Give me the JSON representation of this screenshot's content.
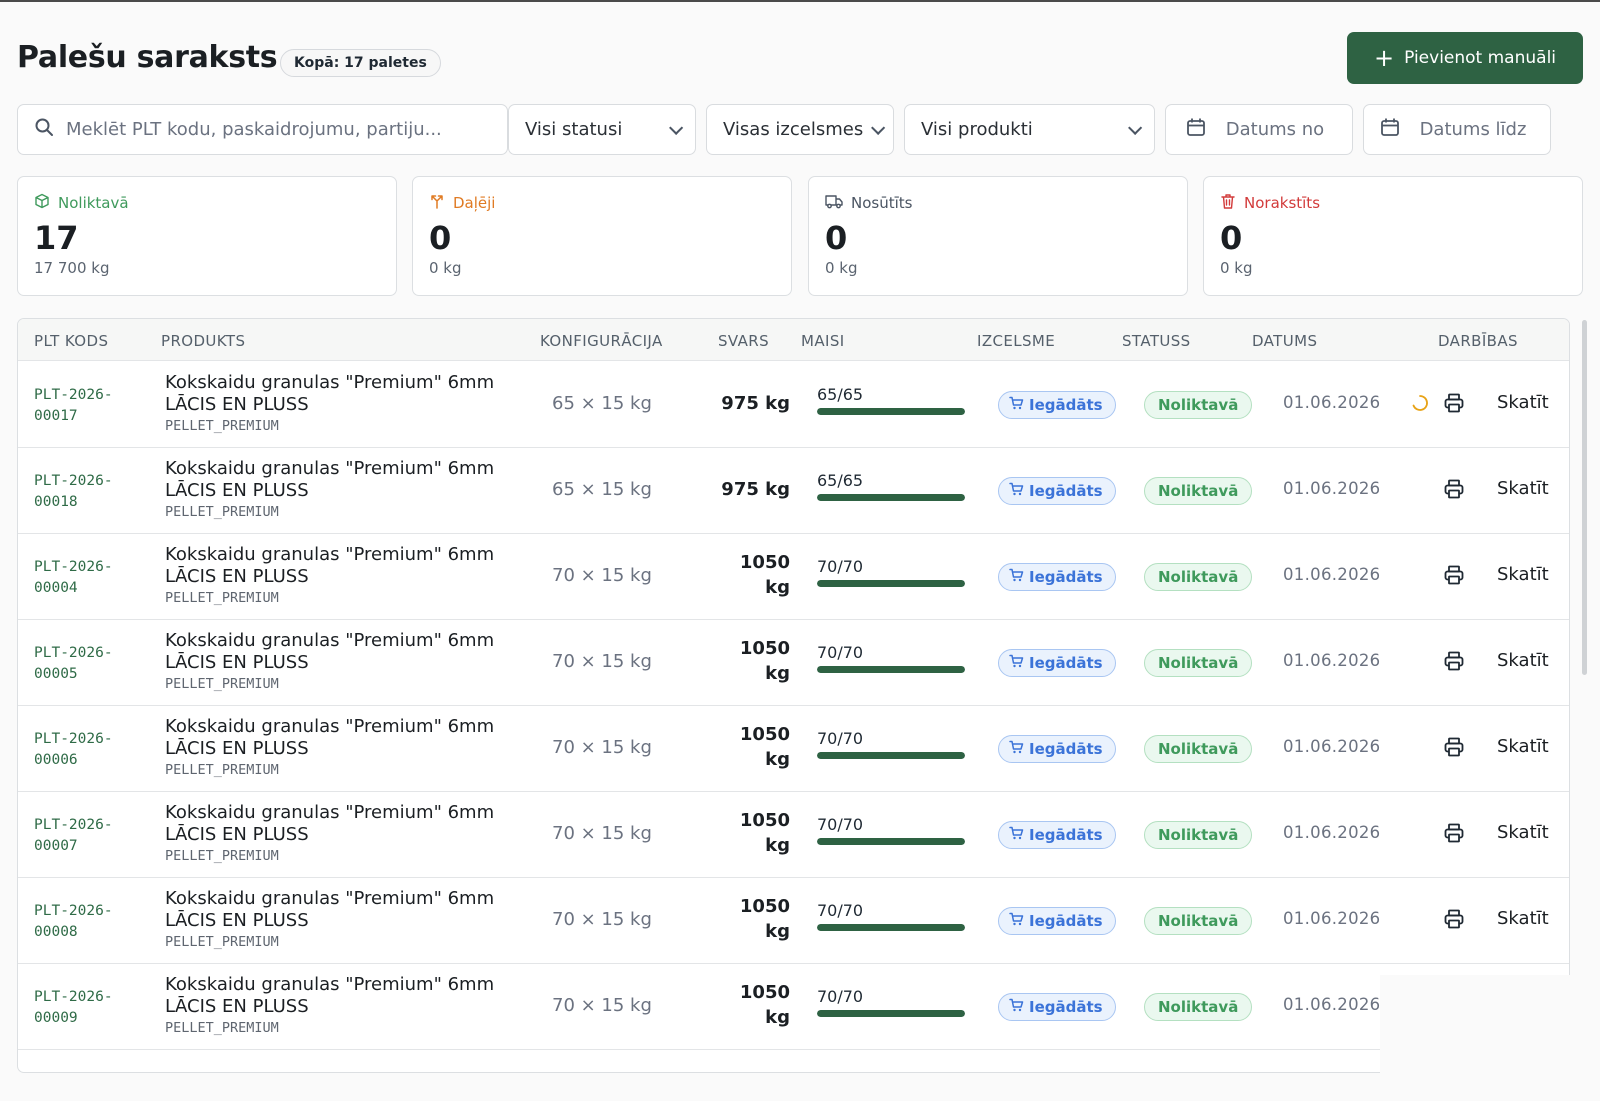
{
  "header": {
    "title": "Palešu saraksts",
    "total_badge": "Kopā: 17 paletes",
    "add_button": "Pievienot manuāli",
    "add_icon": "plus-icon"
  },
  "filters": {
    "search_placeholder": "Meklēt PLT kodu, paskaidrojumu, partiju...",
    "status": "Visi statusi",
    "origin": "Visas izcelsmes",
    "product": "Visi produkti",
    "date_from": "Datums no",
    "date_to": "Datums līdz"
  },
  "stats": [
    {
      "label": "Noliktavā",
      "value": "17",
      "sub": "17 700 kg",
      "color": "#3f9a5c",
      "icon": "box-icon"
    },
    {
      "label": "Daļēji",
      "value": "0",
      "sub": "0 kg",
      "color": "#e07b24",
      "icon": "split-icon"
    },
    {
      "label": "Nosūtīts",
      "value": "0",
      "sub": "0 kg",
      "color": "#4b5563",
      "icon": "truck-icon"
    },
    {
      "label": "Norakstīts",
      "value": "0",
      "sub": "0 kg",
      "color": "#d23b3b",
      "icon": "trash-icon"
    }
  ],
  "table": {
    "columns": [
      "PLT KODS",
      "PRODUKTS",
      "KONFIGURĀCIJA",
      "SVARS",
      "MAISI",
      "IZCELSME",
      "STATUSS",
      "DATUMS",
      "DARBĪBAS"
    ],
    "rows": [
      {
        "code": "PLT-2026-\n00017",
        "product": "Kokskaidu granulas \"Premium\" 6mm LĀCIS EN PLUSS",
        "product_code": "PELLET_PREMIUM",
        "config": "65 × 15 kg",
        "weight": "975 kg",
        "bags": "65/65",
        "fill": 1.0,
        "origin": "Iegādāts",
        "status": "Noliktavā",
        "date": "01.06.2026",
        "view": "Skatīt",
        "loading": true,
        "print": true
      },
      {
        "code": "PLT-2026-\n00018",
        "product": "Kokskaidu granulas \"Premium\" 6mm LĀCIS EN PLUSS",
        "product_code": "PELLET_PREMIUM",
        "config": "65 × 15 kg",
        "weight": "975 kg",
        "bags": "65/65",
        "fill": 1.0,
        "origin": "Iegādāts",
        "status": "Noliktavā",
        "date": "01.06.2026",
        "view": "Skatīt",
        "loading": false,
        "print": true
      },
      {
        "code": "PLT-2026-\n00004",
        "product": "Kokskaidu granulas \"Premium\" 6mm LĀCIS EN PLUSS",
        "product_code": "PELLET_PREMIUM",
        "config": "70 × 15 kg",
        "weight": "1050\nkg",
        "bags": "70/70",
        "fill": 1.0,
        "origin": "Iegādāts",
        "status": "Noliktavā",
        "date": "01.06.2026",
        "view": "Skatīt",
        "loading": false,
        "print": true
      },
      {
        "code": "PLT-2026-\n00005",
        "product": "Kokskaidu granulas \"Premium\" 6mm LĀCIS EN PLUSS",
        "product_code": "PELLET_PREMIUM",
        "config": "70 × 15 kg",
        "weight": "1050\nkg",
        "bags": "70/70",
        "fill": 1.0,
        "origin": "Iegādāts",
        "status": "Noliktavā",
        "date": "01.06.2026",
        "view": "Skatīt",
        "loading": false,
        "print": true
      },
      {
        "code": "PLT-2026-\n00006",
        "product": "Kokskaidu granulas \"Premium\" 6mm LĀCIS EN PLUSS",
        "product_code": "PELLET_PREMIUM",
        "config": "70 × 15 kg",
        "weight": "1050\nkg",
        "bags": "70/70",
        "fill": 1.0,
        "origin": "Iegādāts",
        "status": "Noliktavā",
        "date": "01.06.2026",
        "view": "Skatīt",
        "loading": false,
        "print": true
      },
      {
        "code": "PLT-2026-\n00007",
        "product": "Kokskaidu granulas \"Premium\" 6mm LĀCIS EN PLUSS",
        "product_code": "PELLET_PREMIUM",
        "config": "70 × 15 kg",
        "weight": "1050\nkg",
        "bags": "70/70",
        "fill": 1.0,
        "origin": "Iegādāts",
        "status": "Noliktavā",
        "date": "01.06.2026",
        "view": "Skatīt",
        "loading": false,
        "print": true
      },
      {
        "code": "PLT-2026-\n00008",
        "product": "Kokskaidu granulas \"Premium\" 6mm LĀCIS EN PLUSS",
        "product_code": "PELLET_PREMIUM",
        "config": "70 × 15 kg",
        "weight": "1050\nkg",
        "bags": "70/70",
        "fill": 1.0,
        "origin": "Iegādāts",
        "status": "Noliktavā",
        "date": "01.06.2026",
        "view": "Skatīt",
        "loading": false,
        "print": true
      },
      {
        "code": "PLT-2026-\n00009",
        "product": "Kokskaidu granulas \"Premium\" 6mm LĀCIS EN PLUSS",
        "product_code": "PELLET_PREMIUM",
        "config": "70 × 15 kg",
        "weight": "1050\nkg",
        "bags": "70/70",
        "fill": 1.0,
        "origin": "Iegādāts",
        "status": "Noliktavā",
        "date": "01.06.2026",
        "view": "",
        "loading": false,
        "print": false
      }
    ]
  }
}
